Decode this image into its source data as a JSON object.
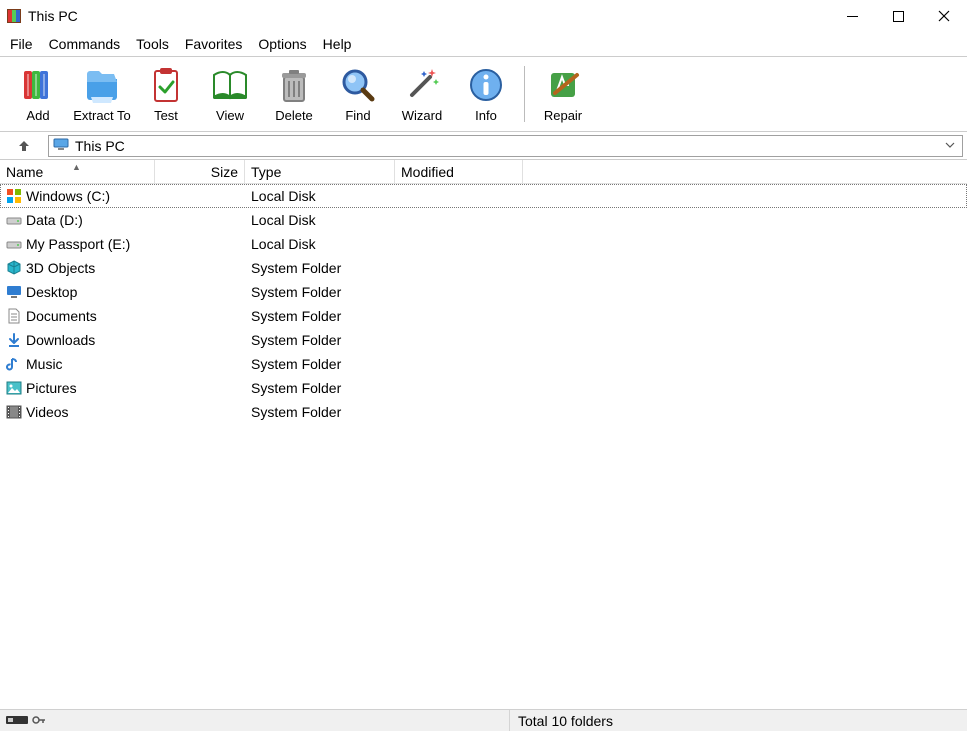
{
  "window": {
    "title": "This PC"
  },
  "menu": {
    "items": [
      "File",
      "Commands",
      "Tools",
      "Favorites",
      "Options",
      "Help"
    ]
  },
  "toolbar": {
    "buttons": [
      {
        "name": "add",
        "label": "Add",
        "icon": "books-icon"
      },
      {
        "name": "extract",
        "label": "Extract To",
        "icon": "folder-out-icon"
      },
      {
        "name": "test",
        "label": "Test",
        "icon": "clipboard-check-icon"
      },
      {
        "name": "view",
        "label": "View",
        "icon": "book-open-icon"
      },
      {
        "name": "delete",
        "label": "Delete",
        "icon": "trash-icon"
      },
      {
        "name": "find",
        "label": "Find",
        "icon": "magnifier-icon"
      },
      {
        "name": "wizard",
        "label": "Wizard",
        "icon": "wand-icon"
      },
      {
        "name": "info",
        "label": "Info",
        "icon": "info-icon"
      }
    ],
    "separator_after": "info",
    "extra": {
      "name": "repair",
      "label": "Repair",
      "icon": "repair-icon"
    }
  },
  "address": {
    "path": "This PC"
  },
  "columns": {
    "name": "Name",
    "size": "Size",
    "type": "Type",
    "modified": "Modified",
    "sort": "name-asc"
  },
  "rows": [
    {
      "name": "Windows (C:)",
      "size": "",
      "type": "Local Disk",
      "modified": "",
      "icon": "drive-windows",
      "selected": true
    },
    {
      "name": "Data (D:)",
      "size": "",
      "type": "Local Disk",
      "modified": "",
      "icon": "drive"
    },
    {
      "name": "My Passport  (E:)",
      "size": "",
      "type": "Local Disk",
      "modified": "",
      "icon": "drive"
    },
    {
      "name": "3D Objects",
      "size": "",
      "type": "System Folder",
      "modified": "",
      "icon": "3d"
    },
    {
      "name": "Desktop",
      "size": "",
      "type": "System Folder",
      "modified": "",
      "icon": "desktop"
    },
    {
      "name": "Documents",
      "size": "",
      "type": "System Folder",
      "modified": "",
      "icon": "document"
    },
    {
      "name": "Downloads",
      "size": "",
      "type": "System Folder",
      "modified": "",
      "icon": "download"
    },
    {
      "name": "Music",
      "size": "",
      "type": "System Folder",
      "modified": "",
      "icon": "music"
    },
    {
      "name": "Pictures",
      "size": "",
      "type": "System Folder",
      "modified": "",
      "icon": "picture"
    },
    {
      "name": "Videos",
      "size": "",
      "type": "System Folder",
      "modified": "",
      "icon": "video"
    }
  ],
  "status": {
    "total": "Total 10 folders"
  }
}
